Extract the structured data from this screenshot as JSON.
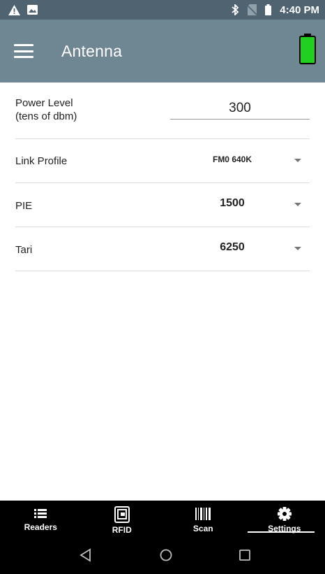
{
  "status_bar": {
    "time": "4:40 PM",
    "left_icons": [
      "warning-icon",
      "image-icon"
    ],
    "right_icons": [
      "bluetooth-icon",
      "no-sim-icon",
      "battery-status-icon"
    ]
  },
  "app_bar": {
    "title": "Antenna",
    "menu_icon": "hamburger-menu-icon",
    "battery_icon": "battery-full-icon",
    "battery_color": "#1fd01f"
  },
  "settings": {
    "power_level": {
      "label_line1": "Power Level",
      "label_line2": "(tens of dbm)",
      "value": "300"
    },
    "link_profile": {
      "label": "Link Profile",
      "value": "FM0 640K"
    },
    "pie": {
      "label": "PIE",
      "value": "1500"
    },
    "tari": {
      "label": "Tari",
      "value": "6250"
    }
  },
  "bottom_nav": {
    "items": [
      {
        "label": "Readers",
        "icon": "list-icon"
      },
      {
        "label": "RFID",
        "icon": "rfid-tag-icon"
      },
      {
        "label": "Scan",
        "icon": "barcode-icon"
      },
      {
        "label": "Settings",
        "icon": "gear-icon"
      }
    ],
    "active": "Settings"
  },
  "system_nav": {
    "buttons": [
      "back-icon",
      "home-icon",
      "recents-icon"
    ]
  },
  "colors": {
    "status_bar": "#4f6370",
    "app_bar": "#6f8793",
    "nav_bg": "#000000"
  }
}
